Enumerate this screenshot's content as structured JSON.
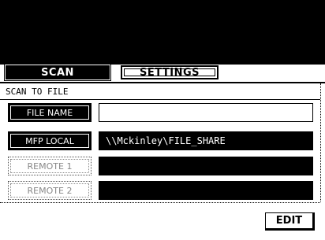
{
  "tabs": {
    "scan_label": "SCAN",
    "settings_label": "SETTINGS"
  },
  "section": {
    "title": "SCAN TO FILE"
  },
  "rows": [
    {
      "button_label": "FILE NAME",
      "value": ""
    },
    {
      "button_label": "MFP LOCAL",
      "value": "\\\\Mckinley\\FILE_SHARE"
    },
    {
      "button_label": "REMOTE 1",
      "value": ""
    },
    {
      "button_label": "REMOTE 2",
      "value": ""
    }
  ],
  "footer": {
    "edit_label": "EDIT"
  },
  "colors": {
    "background": "#ffffff",
    "foreground": "#000000",
    "disabled": "#888888"
  }
}
